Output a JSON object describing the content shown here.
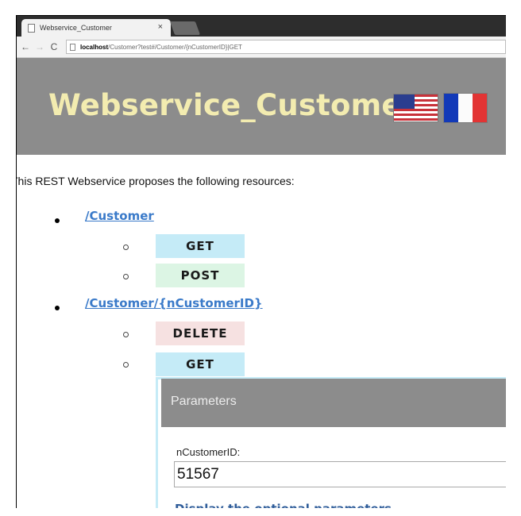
{
  "browser": {
    "tab_title": "Webservice_Customer",
    "tab_close": "×",
    "nav_back": "←",
    "nav_forward": "→",
    "nav_reload": "C",
    "url_host": "localhost",
    "url_path": "/Customer?test#/Customer/{nCustomerID}|GET"
  },
  "header": {
    "title": "Webservice_Customer",
    "flags": [
      "us-flag",
      "france-flag"
    ]
  },
  "content": {
    "intro": "This REST Webservice proposes the following resources:",
    "resources": [
      {
        "path": "/Customer",
        "methods": [
          "GET",
          "POST"
        ]
      },
      {
        "path": "/Customer/{nCustomerID}",
        "methods": [
          "DELETE",
          "GET"
        ]
      }
    ]
  },
  "parameters_panel": {
    "title": "Parameters",
    "field_label": "nCustomerID:",
    "field_value": "51567",
    "optional_link": "Display the optional parameters"
  },
  "colors": {
    "header_bg": "#8c8c8c",
    "title_color": "#f3ecb0",
    "link_color": "#3a7ac9",
    "get_bg": "#c5ebf7",
    "post_bg": "#dcf5e4",
    "delete_bg": "#f6e1e1"
  }
}
